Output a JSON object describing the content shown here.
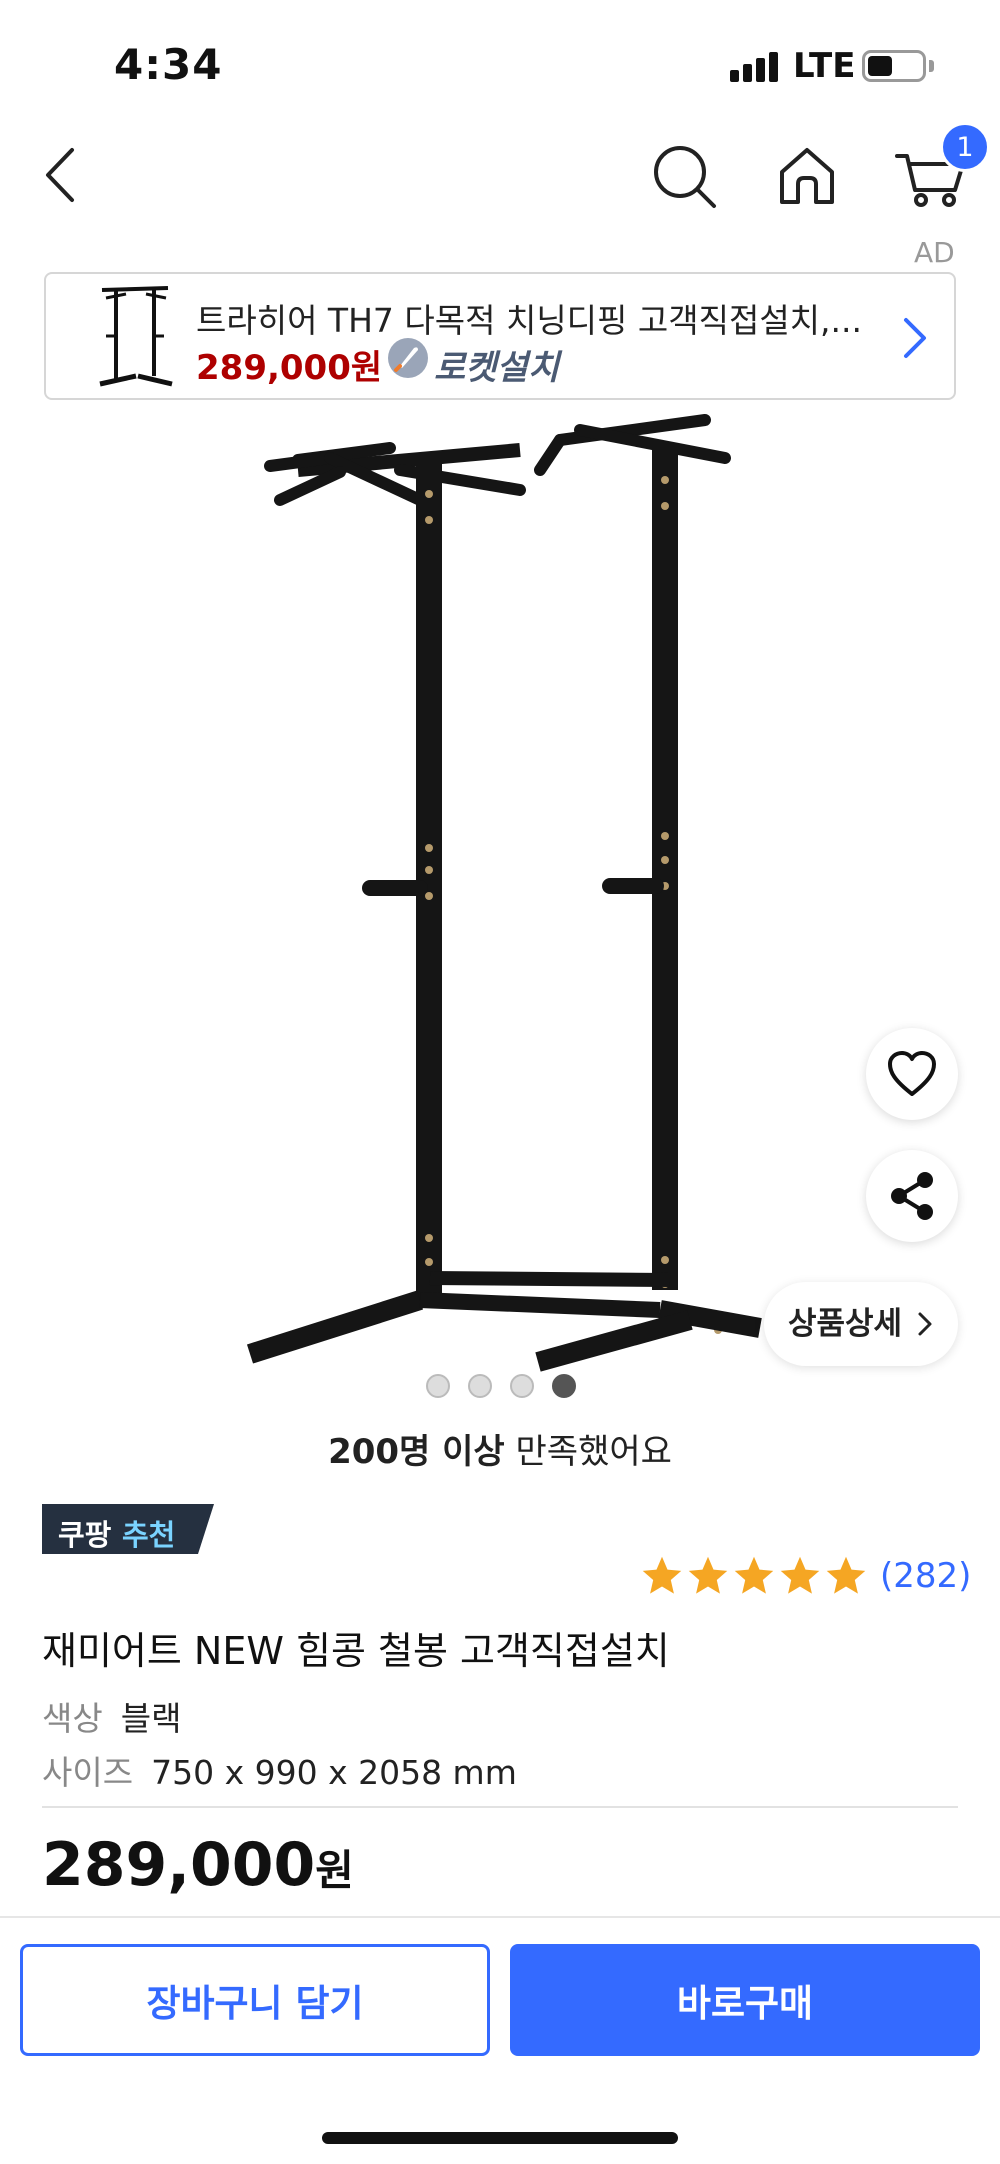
{
  "status_bar": {
    "time": "4:34",
    "network": "LTE"
  },
  "header": {
    "cart_count": "1"
  },
  "ad": {
    "tag": "AD",
    "title": "트라히어 TH7 다목적 치닝디핑 고객직접설치,...",
    "price": "289,000원",
    "install_label": "로켓설치"
  },
  "gallery": {
    "image_count": 4,
    "active_index": 3,
    "detail_button": "상품상세"
  },
  "satisfaction": {
    "strong": "200명 이상",
    "rest": " 만족했어요"
  },
  "badge": {
    "brand": "쿠팡",
    "label": "추천"
  },
  "rating": {
    "stars": 5,
    "reviews": "(282)"
  },
  "product": {
    "name": "재미어트 NEW 힘콩 철봉 고객직접설치",
    "options": [
      {
        "label": "색상",
        "value": "블랙"
      },
      {
        "label": "사이즈",
        "value": "750 x 990 x 2058 mm"
      }
    ],
    "price": "289,000",
    "currency": "원"
  },
  "actions": {
    "add_to_cart": "장바구니 담기",
    "buy_now": "바로구매"
  },
  "colors": {
    "accent": "#346aff",
    "price_red": "#ae0000",
    "star": "#f5a623",
    "dark": "#111111"
  }
}
